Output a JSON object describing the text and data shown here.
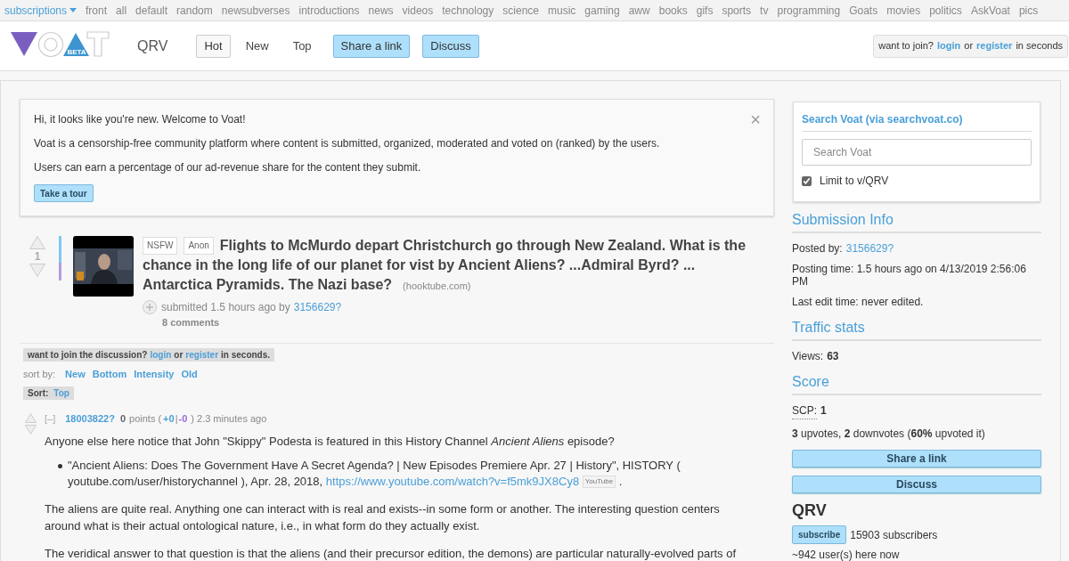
{
  "topnav": {
    "menu": "subscriptions",
    "items": [
      "front",
      "all",
      "default",
      "random",
      "newsubverses",
      "introductions",
      "news",
      "videos",
      "technology",
      "science",
      "music",
      "gaming",
      "aww",
      "books",
      "gifs",
      "sports",
      "tv",
      "programming",
      "Goats",
      "movies",
      "politics",
      "AskVoat",
      "pics"
    ]
  },
  "header": {
    "logo_badge": "BETA",
    "subverse": "QRV",
    "tabs": [
      {
        "label": "Hot",
        "kind": "tab",
        "selected": true
      },
      {
        "label": "New",
        "kind": "tab",
        "selected": false
      },
      {
        "label": "Top",
        "kind": "tab",
        "selected": false
      },
      {
        "label": "Share a link",
        "kind": "action",
        "selected": false
      },
      {
        "label": "Discuss",
        "kind": "action",
        "selected": false
      }
    ],
    "join": {
      "prefix": "want to join?",
      "login": "login",
      "or": "or",
      "register": "register",
      "suffix": "in seconds"
    }
  },
  "welcome": {
    "lines": [
      "Hi, it looks like you're new. Welcome to Voat!",
      "Voat is a censorship-free community platform where content is submitted, organized, moderated and voted on (ranked) by the users.",
      "Users can earn a percentage of our ad-revenue share for the content they submit."
    ],
    "tour_button": "Take a tour",
    "close": "×"
  },
  "post": {
    "score": "1",
    "vote_bar": {
      "level": 0.6
    },
    "thumbnail": {
      "kind": "picture"
    },
    "tags": [
      "NSFW",
      "Anon"
    ],
    "title": "Flights to McMurdo depart Christchurch go through New Zealand. What is the chance in the long life of our planet for vist by Ancient Aliens? ...Admiral Byrd? ... Antarctica Pyramids. The Nazi base?",
    "domain": "(hooktube.com)",
    "submitted": "submitted 1.5 hours ago by",
    "author": "3156629?",
    "comments": "8 comments"
  },
  "discussion": {
    "join": {
      "prefix": "want to join the discussion?",
      "login": "login",
      "or": "or",
      "register": "register",
      "suffix": "in seconds."
    },
    "sort_label": "sort by:",
    "sort_options": [
      "New",
      "Bottom",
      "Intensity",
      "Old"
    ],
    "current_sort": {
      "label": "Sort:",
      "value": "Top"
    }
  },
  "comment": {
    "collapse": "[–]",
    "author": "18003822?",
    "points": "0",
    "points_label": "points (",
    "up": "+0",
    "sep": "|",
    "down": "-0",
    "time": ") 2.3 minutes ago",
    "first_line": "Anyone else here notice that John \"Skippy\" Podesta is featured in this History Channel *Ancient Aliens* episode?",
    "bullet": {
      "text": "\"Ancient Aliens: Does The Government Have A Secret Agenda? | New Episodes Premiere Apr. 27 | History\", HISTORY ( youtube.com/user/historychannel ), Apr. 28, 2018,",
      "link": "https://www.youtube.com/watch?v=f5mk9JX8Cy8",
      "badge": "YouTube",
      "end": "."
    },
    "paragraphs": [
      "The aliens are quite real. Anything one can interact with is real and exists--in some form or another. The interesting question centers around what is their actual ontological nature, i.e., in what form do they actually exist.",
      "The veridical answer to that question is that the aliens (and their precursor edition, the demons) are particular naturally-evolved parts of"
    ]
  },
  "sidebar": {
    "search": {
      "title": "Search Voat (via searchvoat.co)",
      "placeholder": "Search Voat",
      "limit_label": "Limit to v/QRV",
      "checked": true
    },
    "submission_info": {
      "heading": "Submission Info",
      "posted_by": "Posted by:",
      "author": "3156629?",
      "posting_time": "Posting time: 1.5 hours ago on 4/13/2019 2:56:06 PM",
      "last_edit": "Last edit time: never edited."
    },
    "traffic": {
      "heading": "Traffic stats",
      "views_label": "Views:",
      "views": "63"
    },
    "score": {
      "heading": "Score",
      "scp_label": "SCP:",
      "scp": "1",
      "votes": "**3** upvotes, **2** downvotes (**60%** upvoted it)"
    },
    "buttons": [
      "Share a link",
      "Discuss"
    ],
    "subverse": {
      "name": "QRV",
      "subscribe": "subscribe",
      "subscribers": "15903 subscribers",
      "online": "~942 user(s) here now"
    }
  }
}
